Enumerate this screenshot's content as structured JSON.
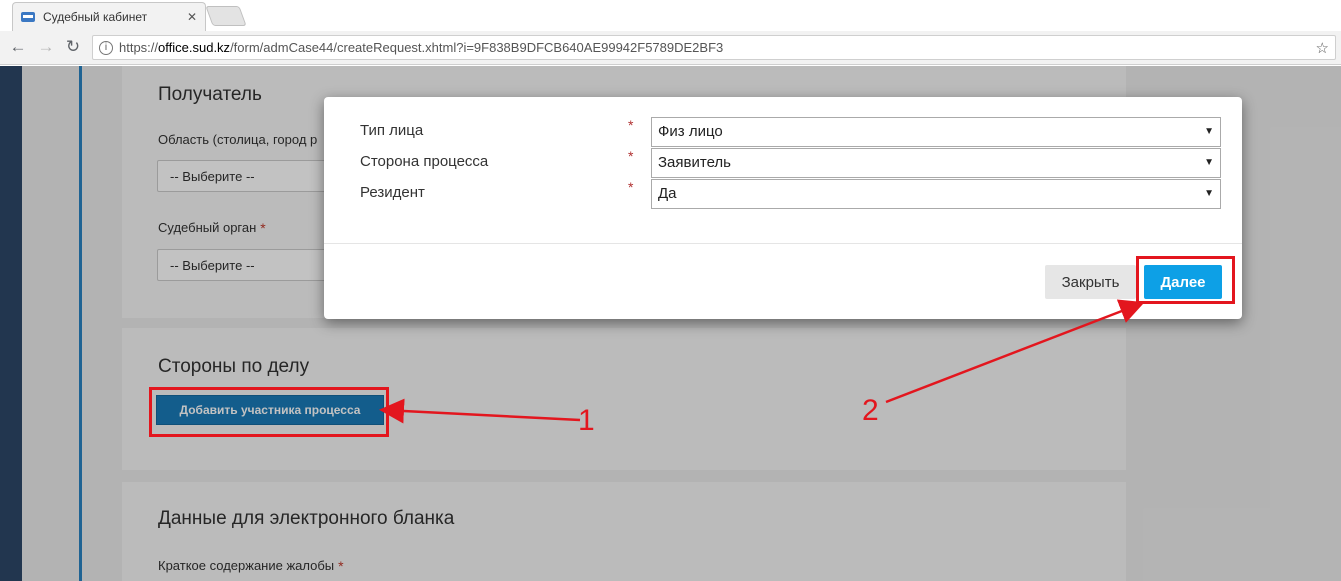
{
  "browser": {
    "tab_title": "Судебный кабинет",
    "tab_close": "✕",
    "url_scheme": "https://",
    "url_host": "office.sud.kz",
    "url_path": "/form/admCase44/createRequest.xhtml?i=9F838B9DFCB640AE99942F5789DE2BF3",
    "icons": [
      "back-icon",
      "forward-icon",
      "reload-icon",
      "info-icon",
      "star-icon"
    ]
  },
  "page": {
    "recipient_card": {
      "title": "Получатель",
      "region_label": "Область (столица, город р",
      "region_select": "-- Выберите --",
      "court_label": "Судебный орган",
      "court_required": "*",
      "court_select": "-- Выберите --"
    },
    "parties_card": {
      "title": "Стороны по делу",
      "add_button": "Добавить участника процесса"
    },
    "blank_card": {
      "title": "Данные для электронного бланка",
      "summary_label": "Краткое содержание жалобы",
      "summary_required": "*"
    }
  },
  "modal": {
    "rows": [
      {
        "label": "Тип лица",
        "required": "*",
        "value": "Физ лицо"
      },
      {
        "label": "Сторона процесса",
        "required": "*",
        "value": "Заявитель"
      },
      {
        "label": "Резидент",
        "required": "*",
        "value": "Да"
      }
    ],
    "close_button": "Закрыть",
    "next_button": "Далее"
  },
  "annotations": {
    "step1": "1",
    "step2": "2",
    "color": "#e3161e"
  }
}
